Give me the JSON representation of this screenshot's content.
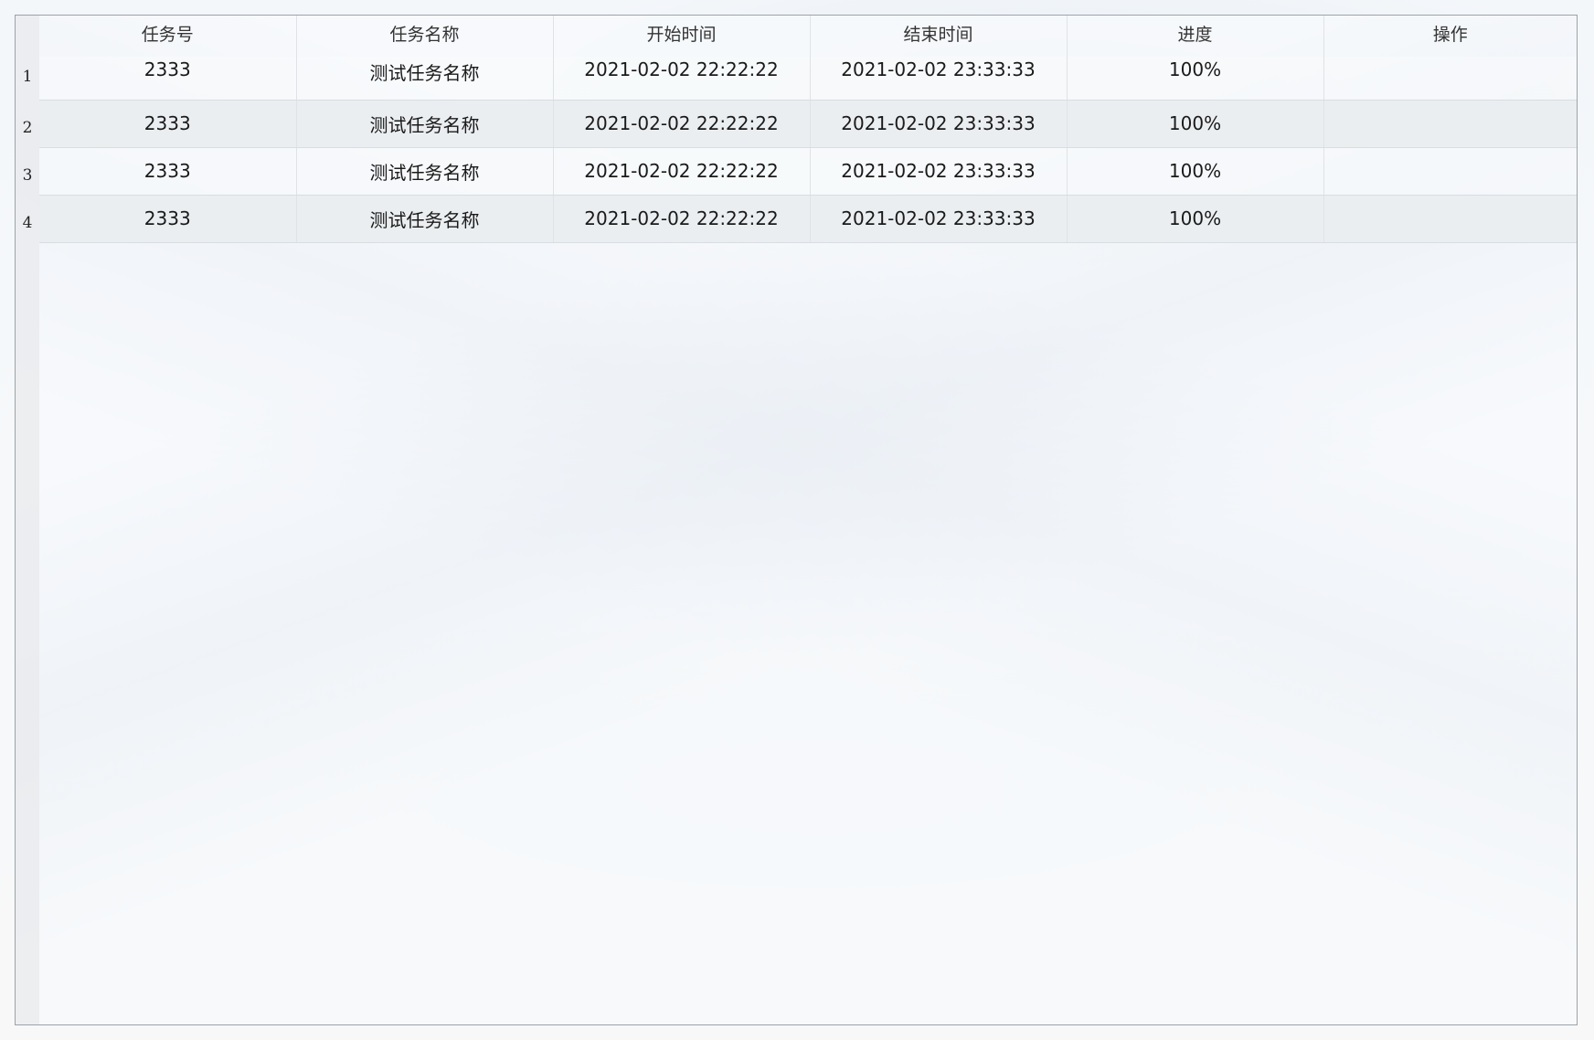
{
  "table": {
    "columns": [
      "任务号",
      "任务名称",
      "开始时间",
      "结束时间",
      "进度",
      "操作"
    ],
    "rows": [
      {
        "num": "1",
        "id": "2333",
        "name": "测试任务名称",
        "start": "2021-02-02 22:22:22",
        "end": "2021-02-02 23:33:33",
        "progress": "100%",
        "action": ""
      },
      {
        "num": "2",
        "id": "2333",
        "name": "测试任务名称",
        "start": "2021-02-02 22:22:22",
        "end": "2021-02-02 23:33:33",
        "progress": "100%",
        "action": ""
      },
      {
        "num": "3",
        "id": "2333",
        "name": "测试任务名称",
        "start": "2021-02-02 22:22:22",
        "end": "2021-02-02 23:33:33",
        "progress": "100%",
        "action": ""
      },
      {
        "num": "4",
        "id": "2333",
        "name": "测试任务名称",
        "start": "2021-02-02 22:22:22",
        "end": "2021-02-02 23:33:33",
        "progress": "100%",
        "action": ""
      }
    ]
  },
  "colors": {
    "border": "#9da3a9",
    "alt_row": "#e9ecef",
    "row_number_column": "#e8eaec"
  }
}
